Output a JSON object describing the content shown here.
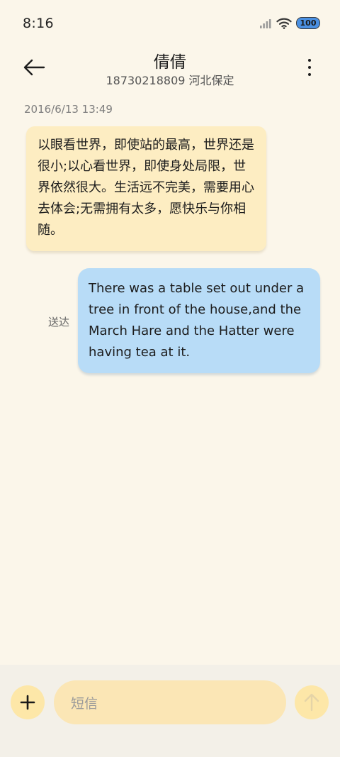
{
  "status_bar": {
    "time": "8:16",
    "battery_level": "100",
    "icons": [
      "signal-icon",
      "wifi-icon",
      "battery-icon"
    ]
  },
  "header": {
    "contact_name": "倩倩",
    "contact_detail": "18730218809 河北保定",
    "back_icon": "arrow-left-icon",
    "more_icon": "more-vertical-icon"
  },
  "conversation": {
    "timestamp": "2016/6/13 13:49",
    "messages": [
      {
        "direction": "incoming",
        "text": "以眼看世界，即使站的最高，世界还是很小;以心看世界，即使身处局限，世界依然很大。生活远不完美，需要用心去体会;无需拥有太多，愿快乐与你相随。"
      },
      {
        "direction": "outgoing",
        "text": "There was a table set out under a tree in front of the house,and the March Hare and the Hatter were having tea at it.",
        "status": "送达"
      }
    ]
  },
  "composer": {
    "placeholder": "短信",
    "add_icon": "plus-icon",
    "send_icon": "arrow-up-icon"
  },
  "colors": {
    "background": "#fbf6ea",
    "incoming_bubble": "#fdedc2",
    "outgoing_bubble": "#b8dcf7",
    "composer_button": "#fde7a8",
    "battery_fill": "#4a90e2"
  }
}
